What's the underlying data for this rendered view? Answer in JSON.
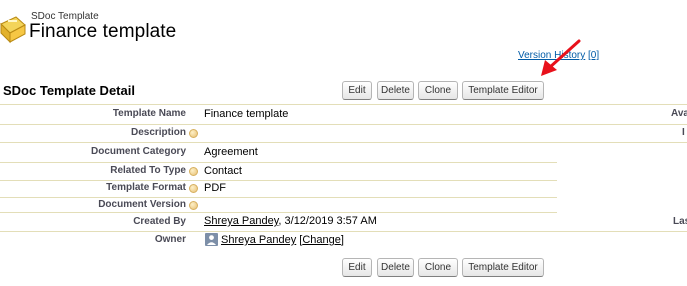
{
  "header": {
    "object_type": "SDoc Template",
    "record_name": "Finance template",
    "version_history_label": "Version History",
    "version_history_count": "[0]"
  },
  "section": {
    "title": "SDoc Template Detail"
  },
  "buttons": {
    "edit": "Edit",
    "delete": "Delete",
    "clone": "Clone",
    "template_editor": "Template Editor"
  },
  "fields": {
    "template_name": {
      "label": "Template Name",
      "value": "Finance template"
    },
    "description": {
      "label": "Description",
      "value": ""
    },
    "document_category": {
      "label": "Document Category",
      "value": "Agreement"
    },
    "related_to_type": {
      "label": "Related To Type",
      "value": "Contact"
    },
    "template_format": {
      "label": "Template Format",
      "value": "PDF"
    },
    "document_version": {
      "label": "Document Version",
      "value": ""
    },
    "created_by": {
      "label": "Created By",
      "user": "Shreya Pandey",
      "date": ", 3/12/2019 3:57 AM"
    },
    "owner": {
      "label": "Owner",
      "user": "Shreya Pandey",
      "change_label": "Change"
    }
  },
  "right_column": {
    "label_1": "Ava",
    "label_2": "I",
    "label_3": "Las"
  },
  "colors": {
    "row_divider": "#e3deb8",
    "arrow": "#e8111b",
    "link": "#015ba7"
  },
  "icons": [
    "template-logo-icon",
    "help-icon",
    "user-icon",
    "red-arrow"
  ]
}
